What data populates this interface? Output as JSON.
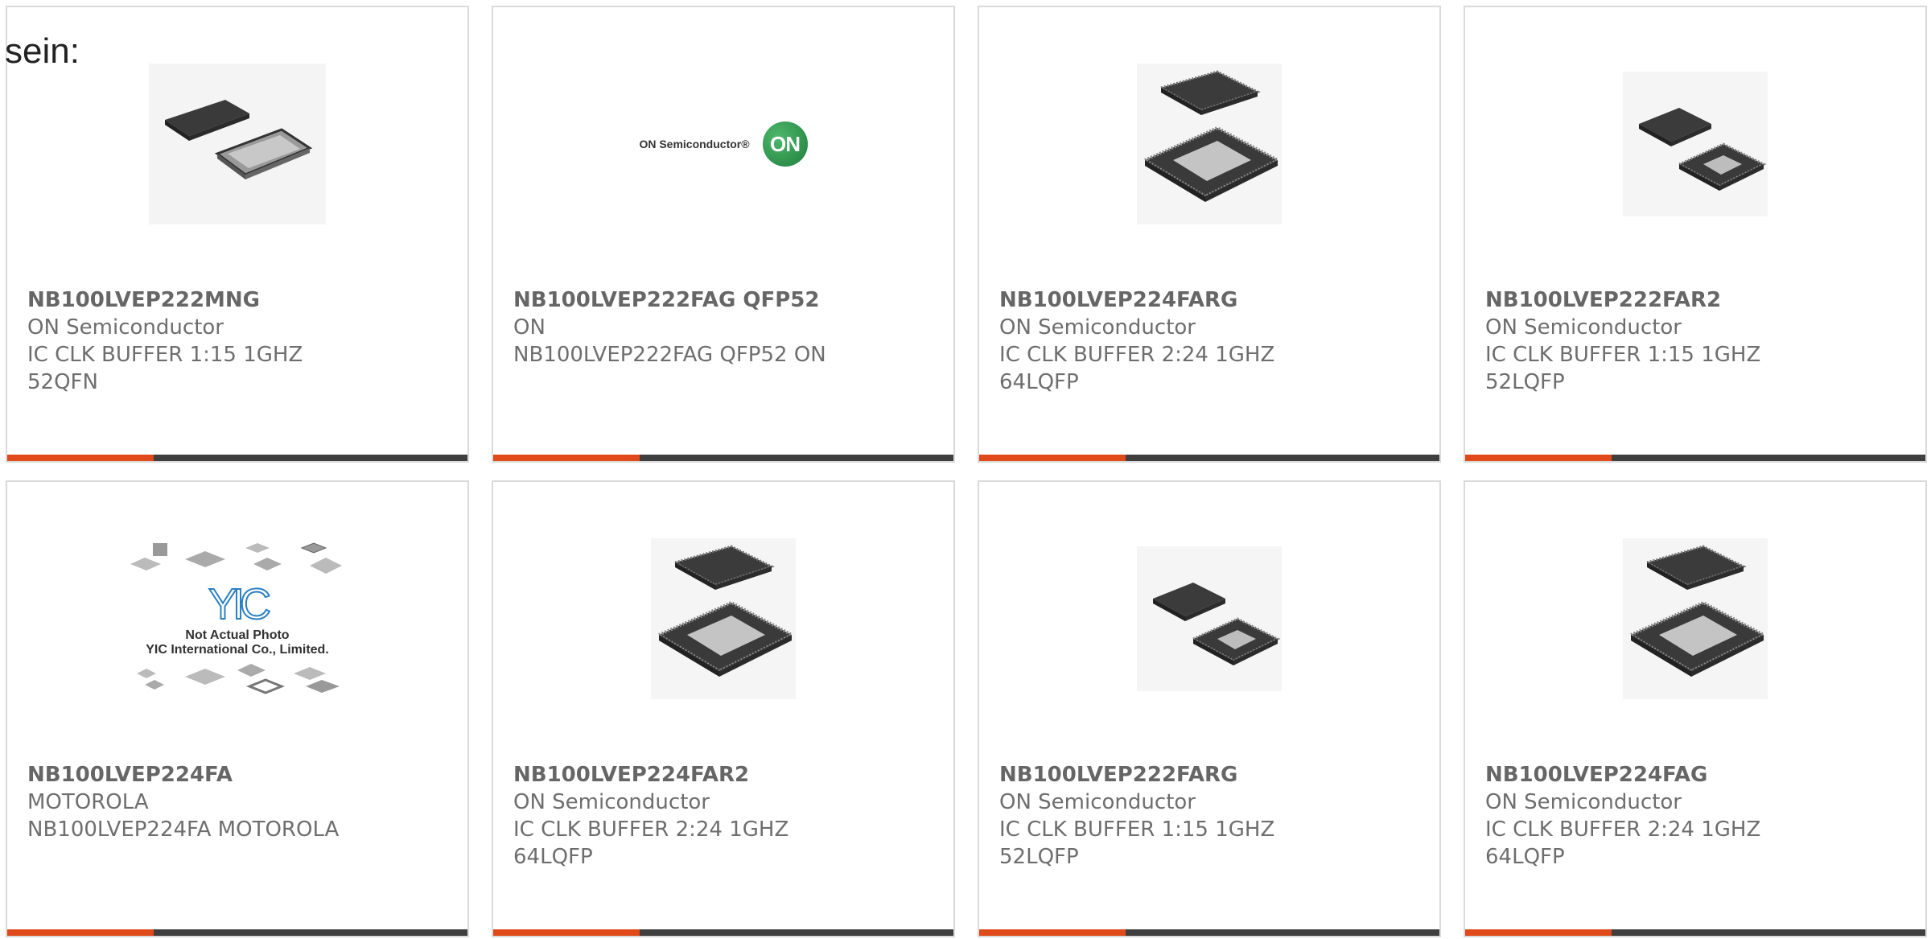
{
  "intro_text": "sein:",
  "logo_text": {
    "on_brand": "ON Semiconductor®",
    "on_mark": "ON",
    "yic_mark": "YIC",
    "yic_caption_1": "Not Actual Photo",
    "yic_caption_2": "YIC International Co., Limited."
  },
  "colors": {
    "accent": "#e04a1a",
    "bar": "#3f3f3f",
    "border": "#dadada",
    "text": "#6e6e6e"
  },
  "products": [
    {
      "part": "NB100LVEP222MNG",
      "maker": "ON Semiconductor",
      "desc1": "IC CLK BUFFER 1:15 1GHZ",
      "desc2": "52QFN",
      "image": "qfn-chip"
    },
    {
      "part": "NB100LVEP222FAG QFP52",
      "maker": "ON",
      "desc1": "NB100LVEP222FAG QFP52 ON",
      "desc2": "",
      "image": "on-semi-logo"
    },
    {
      "part": "NB100LVEP224FARG",
      "maker": "ON Semiconductor",
      "desc1": "IC CLK BUFFER 2:24 1GHZ",
      "desc2": "64LQFP",
      "image": "lqfp-chip-large"
    },
    {
      "part": "NB100LVEP222FAR2",
      "maker": "ON Semiconductor",
      "desc1": "IC CLK BUFFER 1:15 1GHZ",
      "desc2": "52LQFP",
      "image": "lqfp-chip-small"
    },
    {
      "part": "NB100LVEP224FA",
      "maker": "MOTOROLA",
      "desc1": "NB100LVEP224FA MOTOROLA",
      "desc2": "",
      "image": "yic-not-actual-photo"
    },
    {
      "part": "NB100LVEP224FAR2",
      "maker": "ON Semiconductor",
      "desc1": "IC CLK BUFFER 2:24 1GHZ",
      "desc2": "64LQFP",
      "image": "lqfp-chip-large"
    },
    {
      "part": "NB100LVEP222FARG",
      "maker": "ON Semiconductor",
      "desc1": "IC CLK BUFFER 1:15 1GHZ",
      "desc2": "52LQFP",
      "image": "lqfp-chip-small"
    },
    {
      "part": "NB100LVEP224FAG",
      "maker": "ON Semiconductor",
      "desc1": "IC CLK BUFFER 2:24 1GHZ",
      "desc2": "64LQFP",
      "image": "lqfp-chip-large"
    }
  ]
}
